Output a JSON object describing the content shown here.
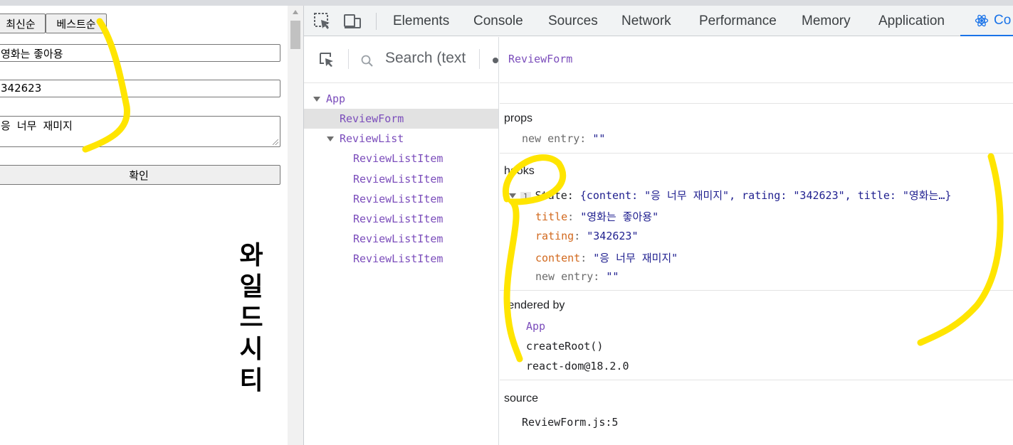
{
  "app": {
    "sort_buttons": [
      "최신순",
      "베스트순"
    ],
    "title_input_value": "영화는 좋아용",
    "rating_input_value": "342623",
    "content_textarea_value": "응 너무 재미지",
    "confirm_label": "확인",
    "vertical_title": [
      "와",
      "일",
      "드",
      "시",
      "티"
    ]
  },
  "devtools": {
    "tabs": [
      "Elements",
      "Console",
      "Sources",
      "Network",
      "Performance",
      "Memory",
      "Application",
      "Co"
    ],
    "active_tab": "Co",
    "search_placeholder": "Search (text",
    "tree": [
      {
        "label": "App",
        "depth": 0,
        "expanded": true
      },
      {
        "label": "ReviewForm",
        "depth": 1,
        "selected": true
      },
      {
        "label": "ReviewList",
        "depth": 1,
        "expanded": true
      },
      {
        "label": "ReviewListItem",
        "depth": 2
      },
      {
        "label": "ReviewListItem",
        "depth": 2
      },
      {
        "label": "ReviewListItem",
        "depth": 2
      },
      {
        "label": "ReviewListItem",
        "depth": 2
      },
      {
        "label": "ReviewListItem",
        "depth": 2
      },
      {
        "label": "ReviewListItem",
        "depth": 2
      }
    ],
    "inspector": {
      "component_name": "ReviewForm",
      "props_title": "props",
      "props": [
        {
          "key": "new entry",
          "value": "\"\""
        }
      ],
      "hooks_title": "hooks",
      "hook_index": "1",
      "hook_summary_key": "State",
      "hook_summary_value": "{content: \"응 너무 재미지\", rating: \"342623\", title: \"영화는…}",
      "hook_fields": [
        {
          "key": "title",
          "value": "\"영화는 좋아용\"",
          "color": "orange"
        },
        {
          "key": "rating",
          "value": "\"342623\"",
          "color": "orange"
        },
        {
          "key": "content",
          "value": "\"응 너무 재미지\"",
          "color": "orange"
        },
        {
          "key": "new entry",
          "value": "\"\"",
          "color": "gray"
        }
      ],
      "rendered_by_title": "rendered by",
      "rendered_by": [
        "App",
        "createRoot()",
        "react-dom@18.2.0"
      ],
      "source_title": "source",
      "source": "ReviewForm.js:5"
    }
  },
  "colors": {
    "accent": "#1a73e8",
    "component": "#7b4dbb",
    "annotation": "#ffe500"
  }
}
